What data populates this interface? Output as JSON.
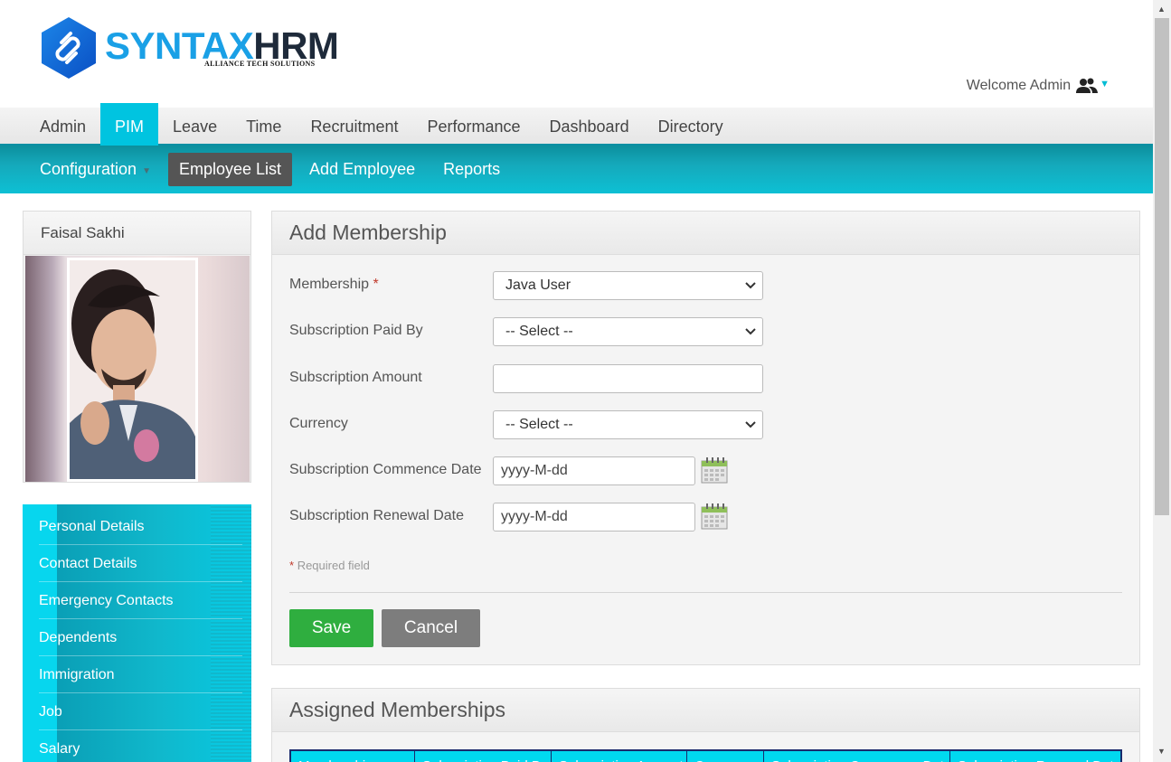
{
  "header": {
    "logo_main": "SYNTAX",
    "logo_accent": "HRM",
    "logo_tagline": "ALLIANCE TECH SOLUTIONS",
    "welcome": "Welcome Admin"
  },
  "mainnav": {
    "items": [
      {
        "label": "Admin"
      },
      {
        "label": "PIM",
        "active": true
      },
      {
        "label": "Leave"
      },
      {
        "label": "Time"
      },
      {
        "label": "Recruitment"
      },
      {
        "label": "Performance"
      },
      {
        "label": "Dashboard"
      },
      {
        "label": "Directory"
      }
    ]
  },
  "subnav": {
    "items": [
      {
        "label": "Configuration"
      },
      {
        "label": "Employee List",
        "active": true
      },
      {
        "label": "Add Employee"
      },
      {
        "label": "Reports"
      }
    ]
  },
  "profile": {
    "name": "Faisal Sakhi"
  },
  "sidemenu": {
    "items": [
      {
        "label": "Personal Details"
      },
      {
        "label": "Contact Details"
      },
      {
        "label": "Emergency Contacts"
      },
      {
        "label": "Dependents"
      },
      {
        "label": "Immigration"
      },
      {
        "label": "Job"
      },
      {
        "label": "Salary"
      }
    ]
  },
  "add_membership": {
    "title": "Add Membership",
    "fields": {
      "membership": {
        "label": "Membership",
        "required_mark": "*",
        "value": "Java User"
      },
      "paid_by": {
        "label": "Subscription Paid By",
        "value": "-- Select --"
      },
      "amount": {
        "label": "Subscription Amount",
        "value": ""
      },
      "currency": {
        "label": "Currency",
        "value": "-- Select --"
      },
      "commence": {
        "label": "Subscription Commence Date",
        "value": "yyyy-M-dd"
      },
      "renewal": {
        "label": "Subscription Renewal Date",
        "value": "yyyy-M-dd"
      }
    },
    "required_note_mark": "*",
    "required_note": "Required field",
    "save_label": "Save",
    "cancel_label": "Cancel"
  },
  "assigned": {
    "title": "Assigned Memberships",
    "columns": [
      "Membership",
      "Subscription Paid By",
      "Subscription Amount",
      "Currency",
      "Subscription Commence Date",
      "Subscription Renewal Date"
    ]
  },
  "colors": {
    "accent": "#00c4e0",
    "subnav": "#15a9bb",
    "save": "#2fae3f",
    "cancel": "#7d7d7d"
  }
}
